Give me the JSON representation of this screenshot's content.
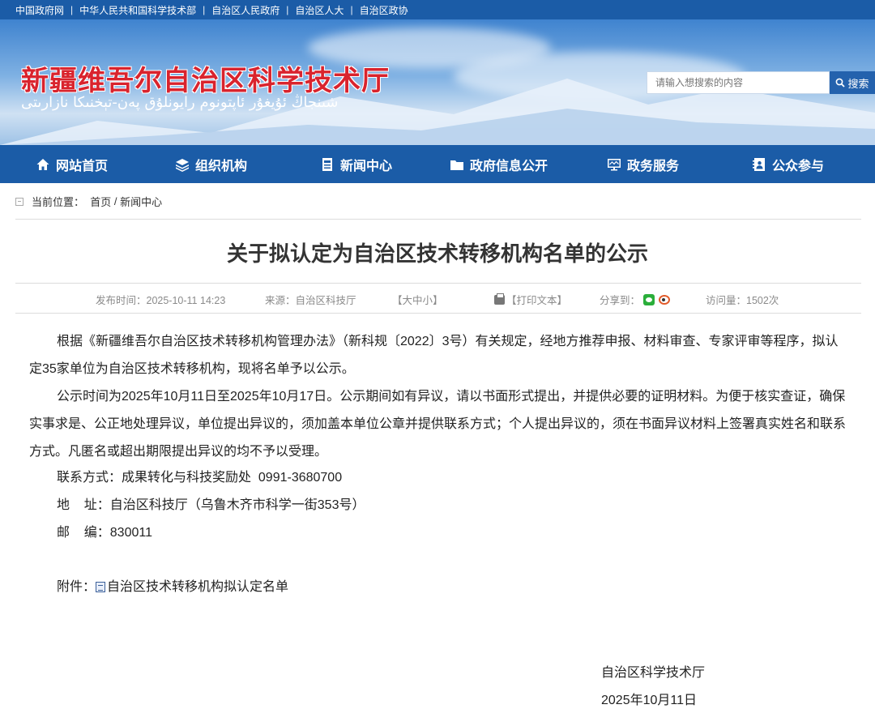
{
  "top_links": [
    "中国政府网",
    "中华人民共和国科学技术部",
    "自治区人民政府",
    "自治区人大",
    "自治区政协"
  ],
  "header": {
    "site_title": "新疆维吾尔自治区科学技术厅",
    "site_title_uyghur": "شىنجاڭ ئۇيغۇر ئاپتونوم رايونلۇق پەن-تېخنىكا نازارىتى",
    "search_placeholder": "请输入想搜索的内容",
    "search_button": "搜索"
  },
  "nav": {
    "items": [
      {
        "label": "网站首页",
        "icon": "home-icon"
      },
      {
        "label": "组织机构",
        "icon": "layers-icon"
      },
      {
        "label": "新闻中心",
        "icon": "news-icon"
      },
      {
        "label": "政府信息公开",
        "icon": "folder-icon"
      },
      {
        "label": "政务服务",
        "icon": "monitor-icon"
      },
      {
        "label": "公众参与",
        "icon": "contact-icon"
      }
    ]
  },
  "breadcrumb": {
    "prefix": "当前位置：",
    "home": "首页",
    "sep": "/",
    "current": "新闻中心"
  },
  "article": {
    "title": "关于拟认定为自治区技术转移机构名单的公示",
    "meta": {
      "published": "发布时间：2025-10-11 14:23",
      "source": "来源：自治区科技厅",
      "font_open": "【",
      "font_large": "大",
      "font_medium": "中",
      "font_small": "小",
      "font_close": "】",
      "print": "【打印文本】",
      "share": "分享到：",
      "share_icons": [
        "wechat-icon",
        "weibo-icon"
      ],
      "views": "访问量：1502次"
    },
    "paragraphs": [
      "根据《新疆维吾尔自治区技术转移机构管理办法》（新科规〔2022〕3号）有关规定，经地方推荐申报、材料审查、专家评审等程序，拟认定35家单位为自治区技术转移机构，现将名单予以公示。",
      "公示时间为2025年10月11日至2025年10月17日。公示期间如有异议，请以书面形式提出，并提供必要的证明材料。为便于核实查证，确保实事求是、公正地处理异议，单位提出异议的，须加盖本单位公章并提供联系方式；个人提出异议的，须在书面异议材料上签署真实姓名和联系方式。凡匿名或超出期限提出异议的均不予以受理。"
    ],
    "contact": "联系方式：成果转化与科技奖励处  0991-3680700",
    "address": "地    址：自治区科技厅（乌鲁木齐市科学一街353号）",
    "postcode": "邮    编：830011",
    "attachment_label": "附件：",
    "attachment_link": "自治区技术转移机构拟认定名单",
    "signature_org": "自治区科学技术厅",
    "signature_date": "2025年10月11日"
  },
  "colors": {
    "nav_bg": "#1b5ca7",
    "title_red": "#d9232d",
    "search_btn": "#2462ad"
  }
}
